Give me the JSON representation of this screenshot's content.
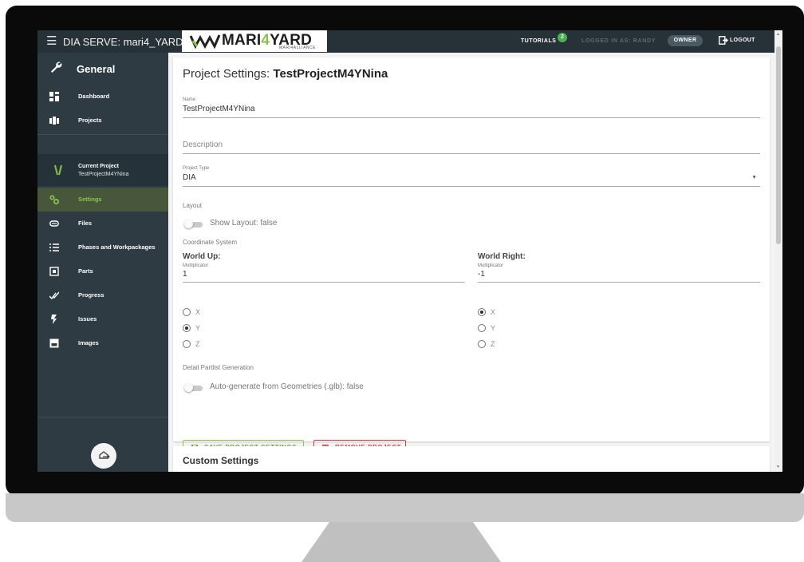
{
  "app": {
    "title": "DIA SERVE: mari4_YARD"
  },
  "logo": {
    "prefix": "MARI",
    "accent": "4",
    "suffix": "YARD",
    "subtitle": "MARI4ALLIANCE"
  },
  "topbar": {
    "tutorials_label": "TUTORIALS",
    "tutorials_badge": "2",
    "logged_in_text": "LOGGED IN AS: RANDY",
    "role_chip": "OWNER",
    "logout_label": "LOGOUT"
  },
  "sidebar": {
    "header": "General",
    "items_top": [
      {
        "label": "Dashboard",
        "icon": "dashboard-icon"
      },
      {
        "label": "Projects",
        "icon": "projects-icon"
      }
    ],
    "current_project": {
      "label": "Current Project",
      "name": "TestProjectM4YNina"
    },
    "items": [
      {
        "label": "Settings",
        "icon": "gears-icon",
        "active": true
      },
      {
        "label": "Files",
        "icon": "paperclip-icon"
      },
      {
        "label": "Phases and Workpackages",
        "icon": "list-icon"
      },
      {
        "label": "Parts",
        "icon": "parts-icon"
      },
      {
        "label": "Progress",
        "icon": "check-icon"
      },
      {
        "label": "Issues",
        "icon": "flash-icon"
      },
      {
        "label": "Images",
        "icon": "image-icon"
      }
    ]
  },
  "settings": {
    "title_prefix": "Project Settings:",
    "title_project": "TestProjectM4YNina",
    "name_label": "Name",
    "name_value": "TestProjectM4YNina",
    "description_placeholder": "Description",
    "project_type_label": "Project Type",
    "project_type_value": "DIA",
    "layout_section": "Layout",
    "show_layout": "Show Layout: false",
    "coordinate_section": "Coordinate System",
    "world_up": {
      "title": "World Up:",
      "mult_label": "Multiplicator",
      "mult_value": "1",
      "options": [
        "X",
        "Y",
        "Z"
      ],
      "selected": "Y"
    },
    "world_right": {
      "title": "World Right:",
      "mult_label": "Multiplicator",
      "mult_value": "-1",
      "options": [
        "X",
        "Y",
        "Z"
      ],
      "selected": "X"
    },
    "partlist_section": "Detail Partlist Generation",
    "autogenerate": "Auto-generate from Geometries (.glb): false",
    "save_button": "SAVE PROJECT SETTINGS",
    "remove_button": "REMOVE PROJECT"
  },
  "custom_settings": {
    "title": "Custom Settings"
  },
  "colors": {
    "accent": "#8bc34a",
    "sidebar": "#2e3b42",
    "topbar": "#263238",
    "danger": "#e53935"
  }
}
